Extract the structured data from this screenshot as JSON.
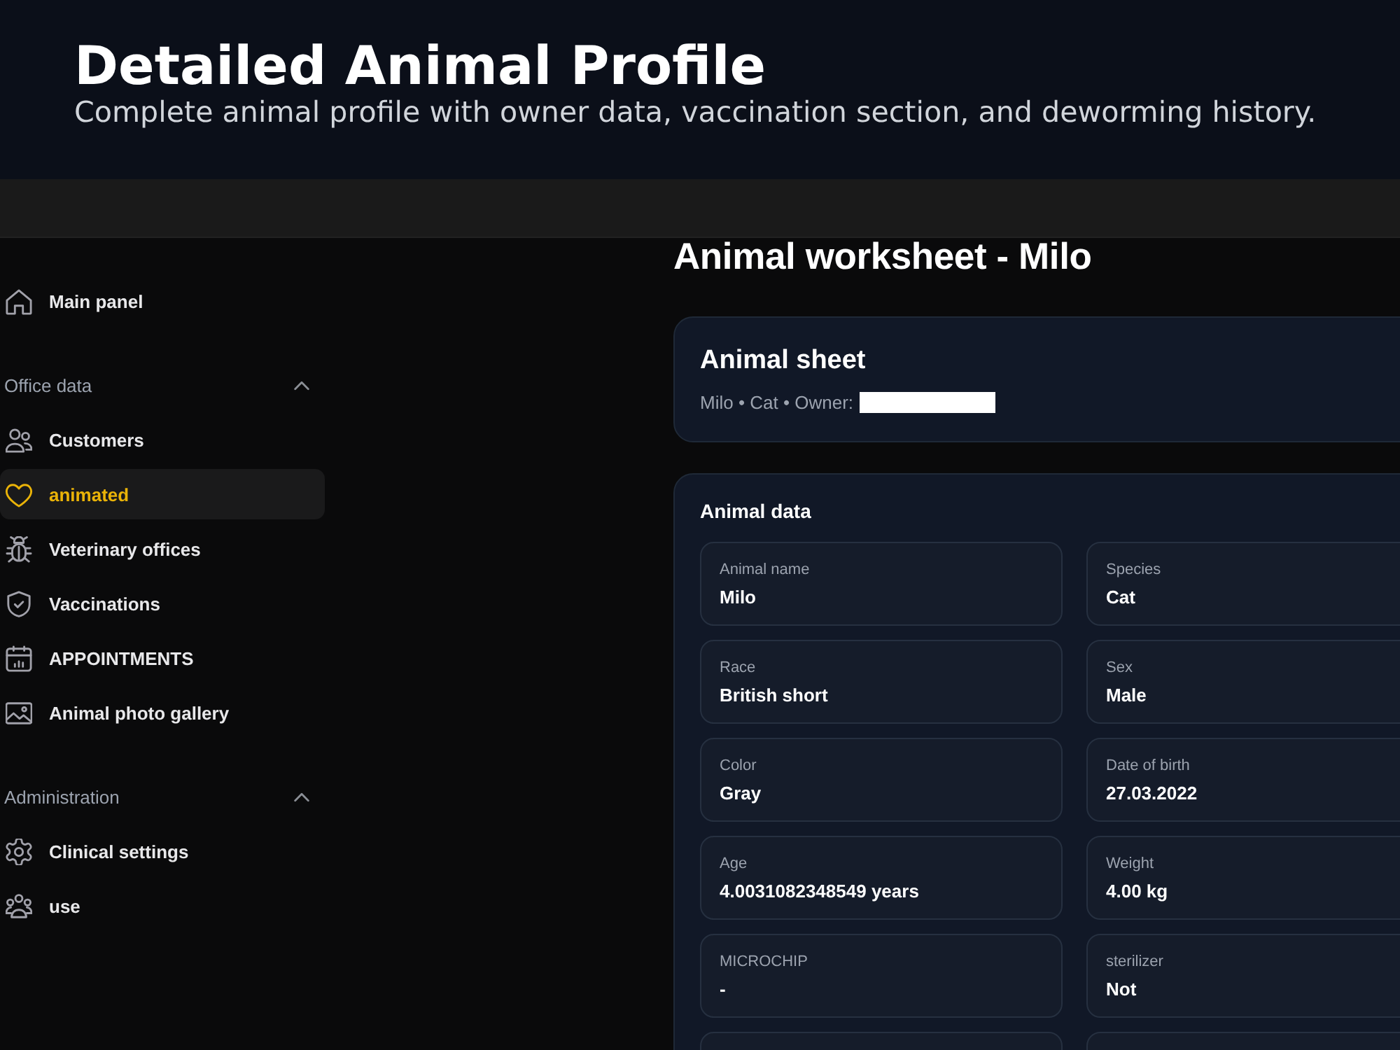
{
  "header": {
    "title": "Detailed Animal Profile",
    "subtitle": "Complete animal profile with owner data, vaccination section, and deworming history."
  },
  "sidebar": {
    "groups": [
      {
        "items": [
          {
            "label": "Main panel",
            "selected": false
          }
        ]
      },
      {
        "title": "Office data",
        "expanded": true,
        "items": [
          {
            "label": "Customers",
            "selected": false
          },
          {
            "label": "animated",
            "selected": true
          },
          {
            "label": "Veterinary offices",
            "selected": false
          },
          {
            "label": "Vaccinations",
            "selected": false
          },
          {
            "label": "APPOINTMENTS",
            "selected": false
          },
          {
            "label": "Animal photo gallery",
            "selected": false
          }
        ]
      },
      {
        "title": "Administration",
        "expanded": true,
        "items": [
          {
            "label": "Clinical settings",
            "selected": false
          },
          {
            "label": "use",
            "selected": false
          }
        ]
      }
    ]
  },
  "main": {
    "heading": "Animal worksheet - Milo",
    "summary_card": {
      "title": "Animal sheet",
      "subtitle": "Milo • Cat • Owner:",
      "owner_redacted": true
    },
    "data_card": {
      "title": "Animal data",
      "fields": [
        {
          "kind": "field",
          "label": "Animal name",
          "value": "Milo"
        },
        {
          "kind": "field",
          "label": "Species",
          "value": "Cat"
        },
        {
          "kind": "field",
          "label": "Race",
          "value": "British short"
        },
        {
          "kind": "field",
          "label": "Sex",
          "value": "Male"
        },
        {
          "kind": "field",
          "label": "Color",
          "value": "Gray"
        },
        {
          "kind": "field",
          "label": "Date of birth",
          "value": "27.03.2022"
        },
        {
          "kind": "field",
          "label": "Age",
          "value": "4.0031082348549 years"
        },
        {
          "kind": "field",
          "label": "Weight",
          "value": "4.00 kg"
        },
        {
          "kind": "field",
          "label": "MICROCHIP",
          "value": "-"
        },
        {
          "kind": "field",
          "label": "sterilizer",
          "value": "Not"
        },
        {
          "kind": "clipped"
        },
        {
          "kind": "clipped"
        }
      ]
    }
  }
}
